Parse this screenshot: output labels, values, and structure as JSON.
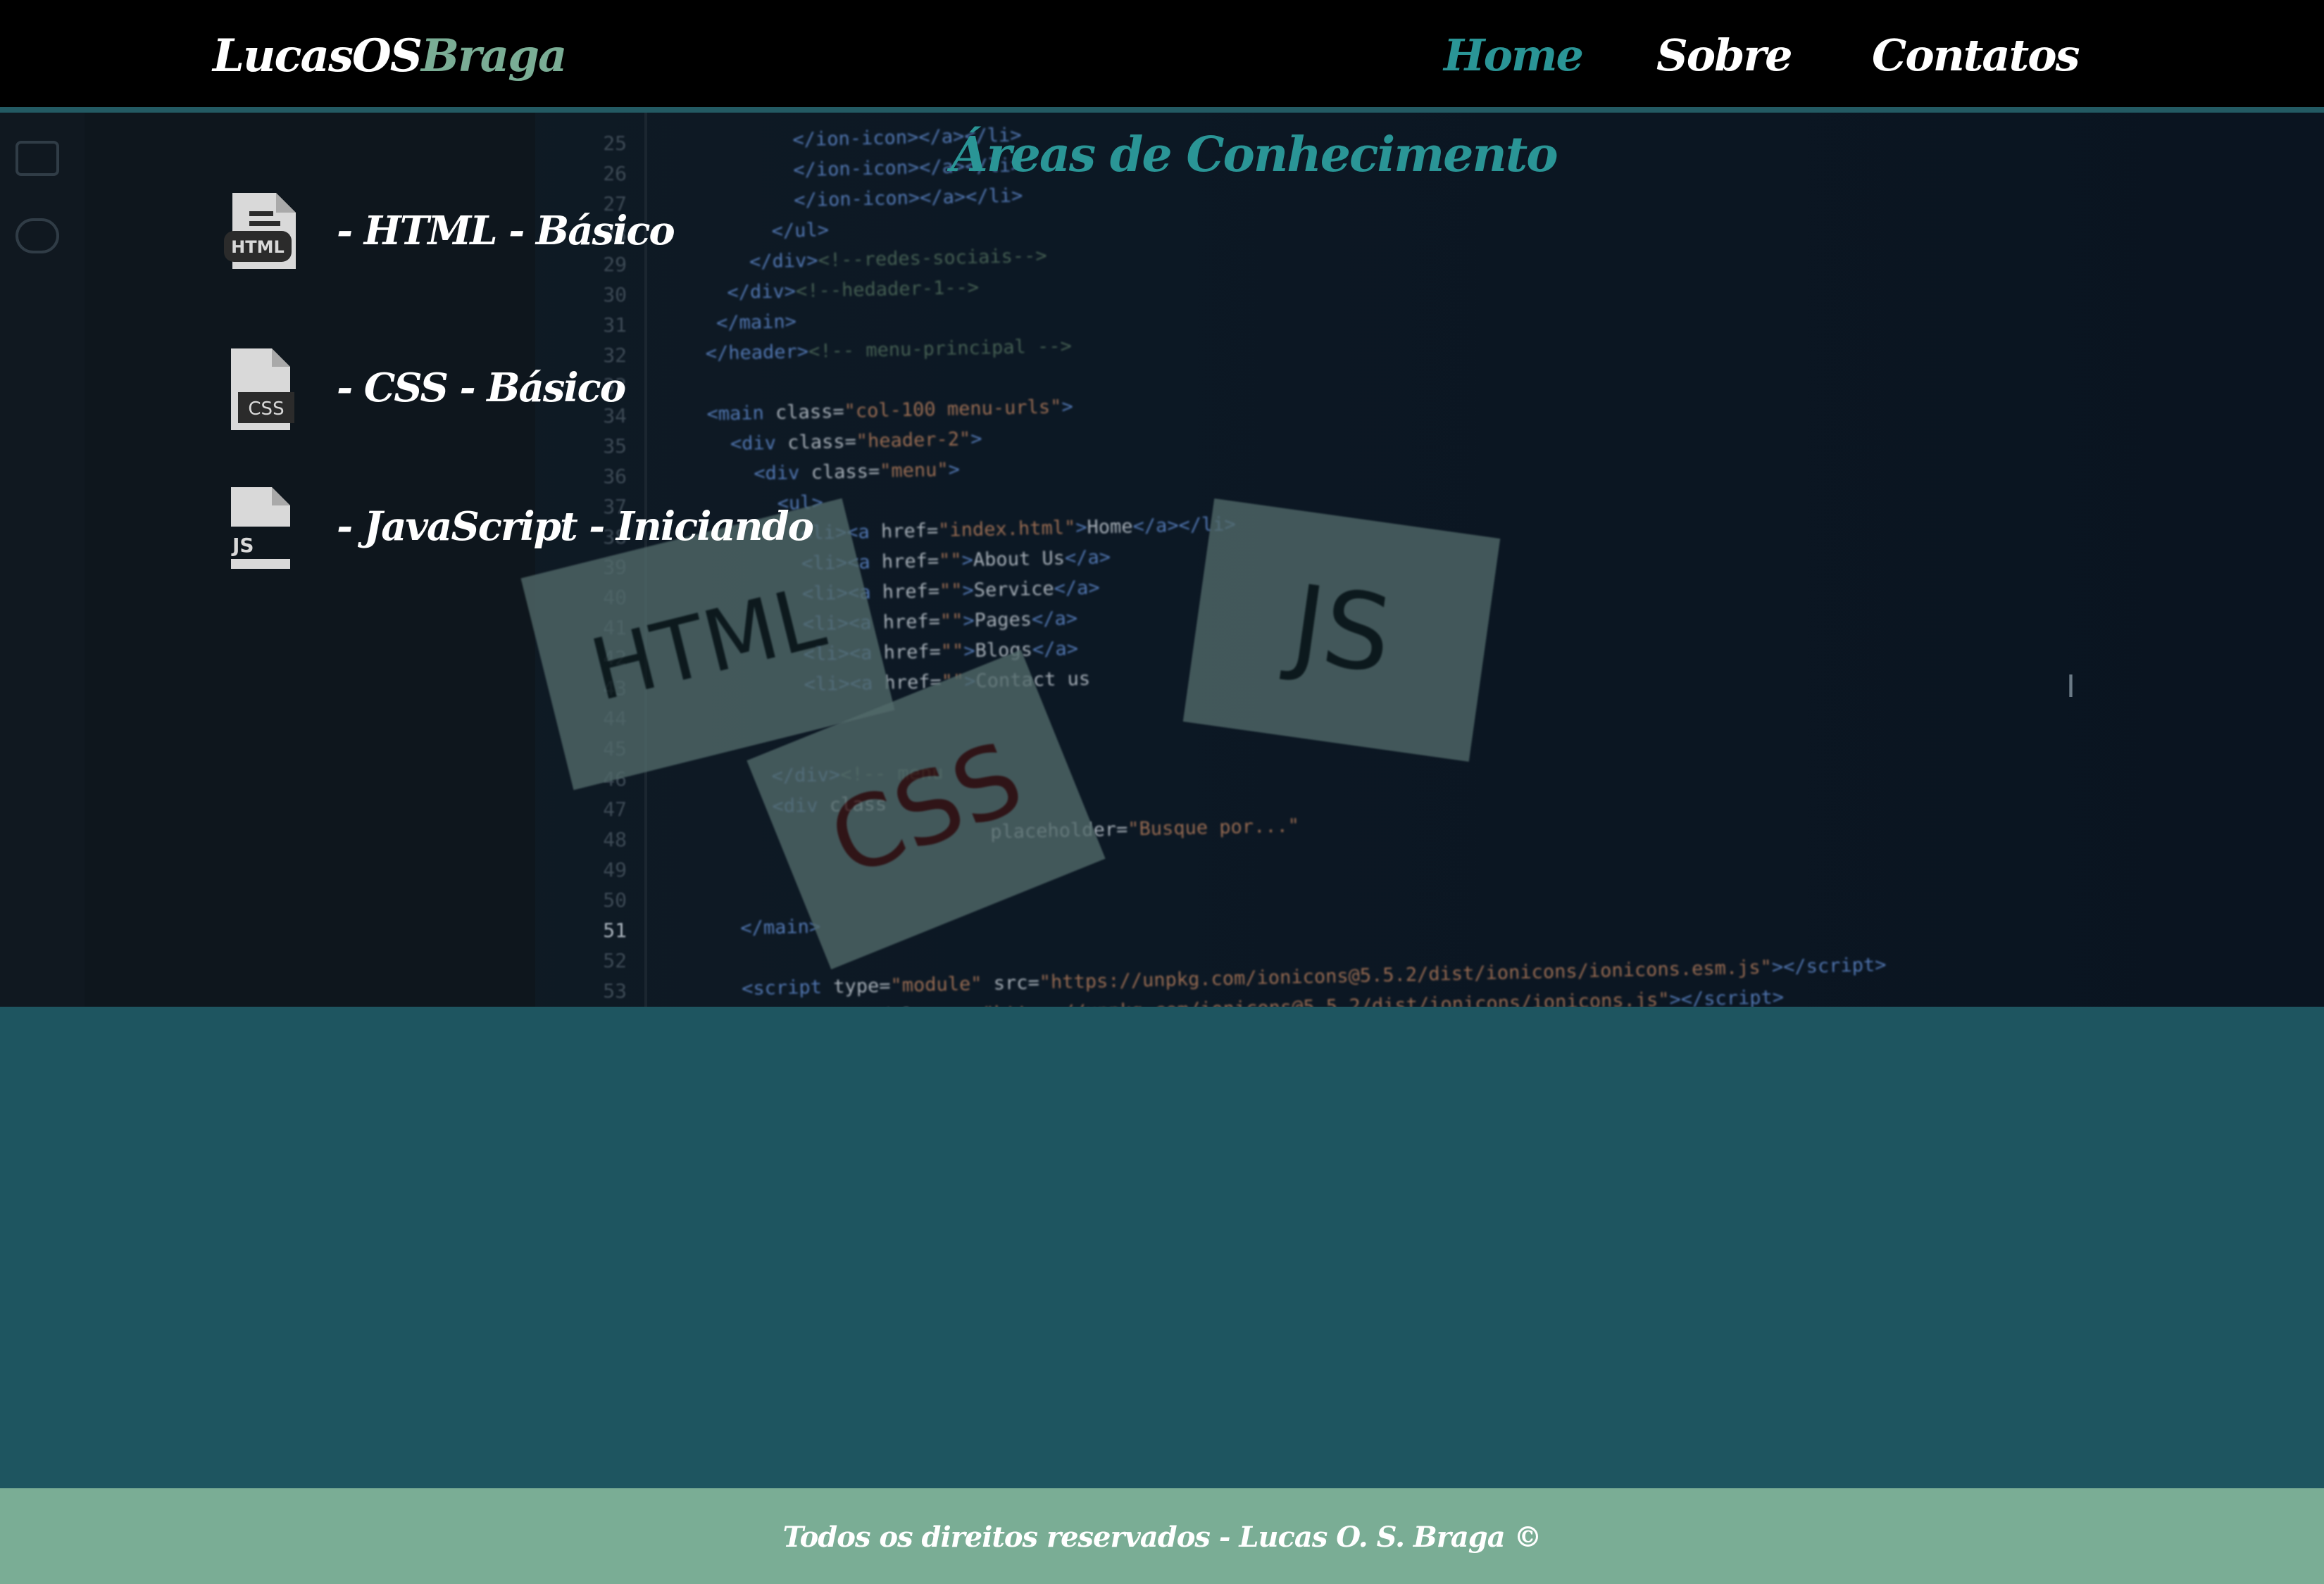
{
  "header": {
    "brand_primary": "LucasOS",
    "brand_accent": "Braga",
    "nav": [
      {
        "label": "Home",
        "active": true
      },
      {
        "label": "Sobre",
        "active": false
      },
      {
        "label": "Contatos",
        "active": false
      }
    ]
  },
  "main": {
    "section_title": "Áreas de Conhecimento",
    "skills": [
      {
        "icon": "html-file-icon",
        "icon_text": "HTML",
        "label": "- HTML - Básico"
      },
      {
        "icon": "css-file-icon",
        "icon_text": "CSS",
        "label": "- CSS - Básico"
      },
      {
        "icon": "js-file-icon",
        "icon_text": "JS",
        "label": "- JavaScript - Iniciando"
      }
    ]
  },
  "footer": {
    "text": "Todos os direitos reservados - Lucas O. S. Braga ©"
  },
  "colors": {
    "header_bg": "#000000",
    "accent_teal": "#2a9596",
    "brand_green": "#7aad95",
    "body_bg": "#1e5560",
    "footer_bg": "#7aad95"
  }
}
